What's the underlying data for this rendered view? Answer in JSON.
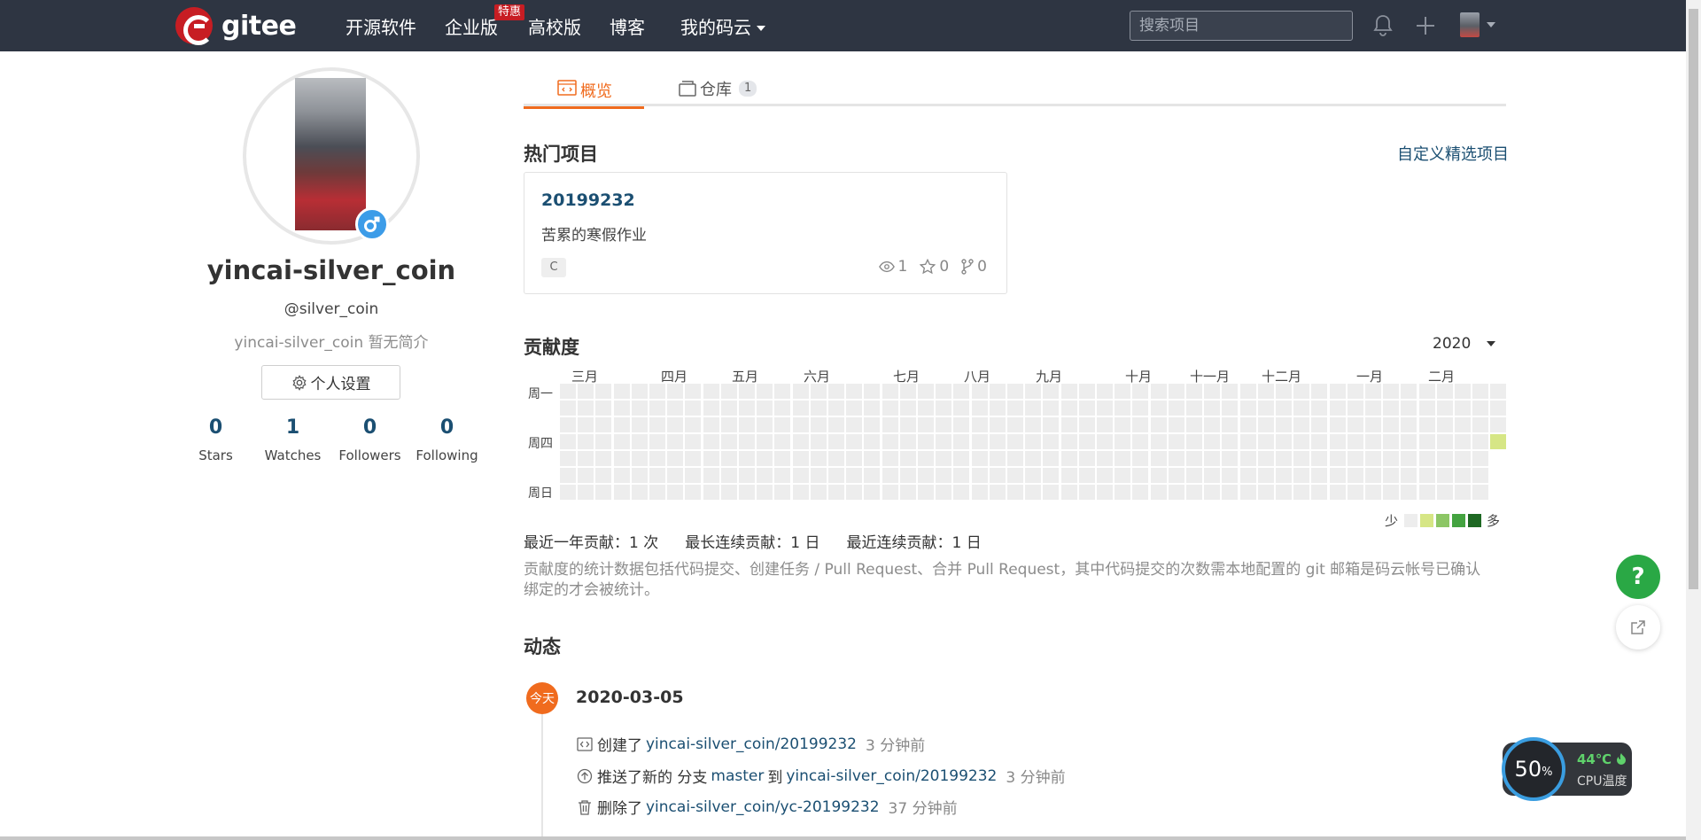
{
  "header": {
    "logo_text": "gitee",
    "nav": [
      {
        "label": "开源软件"
      },
      {
        "label": "企业版",
        "badge": "特惠"
      },
      {
        "label": "高校版"
      },
      {
        "label": "博客"
      },
      {
        "label": "我的码云"
      }
    ],
    "search_placeholder": "搜索项目"
  },
  "profile": {
    "name": "yincai-silver_coin",
    "handle": "@silver_coin",
    "bio": "yincai-silver_coin 暂无简介",
    "settings_label": "个人设置",
    "stats": [
      {
        "value": "0",
        "label": "Stars"
      },
      {
        "value": "1",
        "label": "Watches"
      },
      {
        "value": "0",
        "label": "Followers"
      },
      {
        "value": "0",
        "label": "Following"
      }
    ]
  },
  "tabs": [
    {
      "label": "概览",
      "active": true
    },
    {
      "label": "仓库",
      "count": "1"
    }
  ],
  "popular": {
    "title": "热门项目",
    "customize_link": "自定义精选项目",
    "project": {
      "name": "20199232",
      "description": "苦累的寒假作业",
      "language": "C",
      "watches": "1",
      "stars": "0",
      "forks": "0"
    }
  },
  "contribution": {
    "title": "贡献度",
    "year": "2020",
    "months": [
      "三月",
      "四月",
      "五月",
      "六月",
      "七月",
      "八月",
      "九月",
      "十月",
      "十一月",
      "十二月",
      "一月",
      "二月"
    ],
    "day_labels": [
      "周一",
      "周四",
      "周日"
    ],
    "weeks": 53,
    "active_cells": [
      {
        "week": 52,
        "day": 3,
        "level": 1
      }
    ],
    "legend_less": "少",
    "legend_more": "多",
    "legend_colors": [
      "#ededed",
      "#d6e685",
      "#8cc665",
      "#44a340",
      "#1e6823"
    ],
    "summary": {
      "last_year": "最近一年贡献：1 次",
      "longest": "最长连续贡献：1 日",
      "recent": "最近连续贡献：1 日"
    },
    "note": "贡献度的统计数据包括代码提交、创建任务 / Pull Request、合并 Pull Request，其中代码提交的次数需本地配置的 git 邮箱是码云帐号已确认绑定的才会被统计。"
  },
  "activity": {
    "title": "动态",
    "today_label": "今天",
    "date": "2020-03-05",
    "items": [
      {
        "icon": "code-icon",
        "action": "创建了",
        "target": "yincai-silver_coin/20199232",
        "time": "3 分钟前"
      },
      {
        "icon": "push-icon",
        "action": "推送了新的 分支",
        "branch": "master",
        "connector": "到",
        "target": "yincai-silver_coin/20199232",
        "time": "3 分钟前"
      },
      {
        "icon": "trash-icon",
        "action": "删除了",
        "target": "yincai-silver_coin/yc-20199232",
        "time": "37 分钟前"
      }
    ]
  },
  "floating": {
    "help_label": "?",
    "cpu_percent": "50",
    "cpu_percent_unit": "%",
    "cpu_temp": "44℃",
    "cpu_label": "CPU温度"
  },
  "colors": {
    "header_bg": "#2e3542",
    "brand_red": "#c71d23",
    "accent_orange": "#f06b1e",
    "link_blue": "#1b4f72",
    "help_green": "#2aa845"
  }
}
